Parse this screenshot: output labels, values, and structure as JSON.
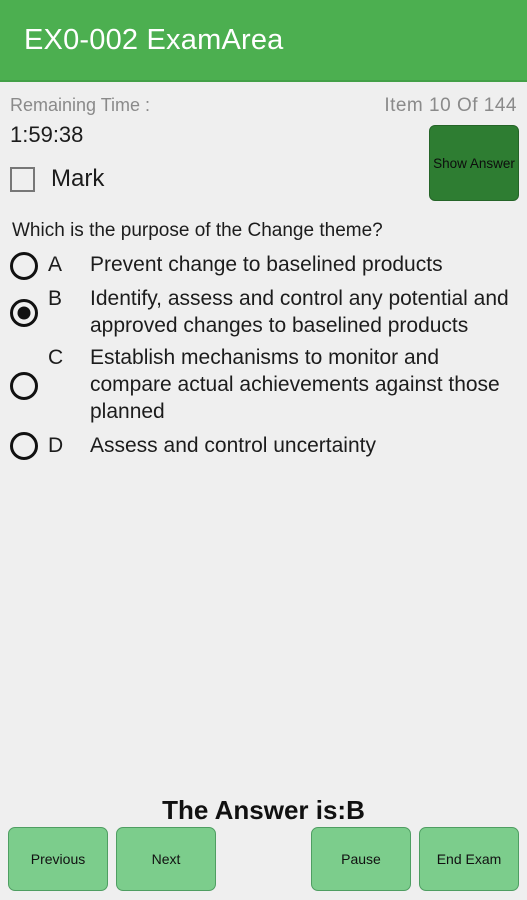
{
  "appbar": {
    "title": "EX0-002 ExamArea",
    "background_color": "#4CAF50",
    "text_color": "#ffffff"
  },
  "status": {
    "remaining_time_label": "Remaining Time :",
    "item_counter": "Item 10 Of 144",
    "current_item": 10,
    "total_items": 144
  },
  "timer": {
    "value": "1:59:38"
  },
  "mark": {
    "label": "Mark",
    "checked": false
  },
  "show_answer": {
    "label": "Show Answer",
    "background_color": "#2e7d32"
  },
  "question": {
    "text": "Which is the purpose of the Change theme?"
  },
  "options": [
    {
      "letter": "A",
      "text": "Prevent change to baselined products",
      "selected": false
    },
    {
      "letter": "B",
      "text": "Identify, assess and control any potential and approved changes to baselined products",
      "selected": true
    },
    {
      "letter": "C",
      "text": "Establish mechanisms to monitor and compare actual achievements against those planned",
      "selected": false
    },
    {
      "letter": "D",
      "text": "Assess and control uncertainty",
      "selected": false
    }
  ],
  "answer_reveal": {
    "text": "The Answer is:B",
    "correct_letter": "B"
  },
  "bottom_buttons": {
    "previous": "Previous",
    "next": "Next",
    "pause": "Pause",
    "end_exam": "End Exam",
    "background_color": "#7ccd8c"
  }
}
